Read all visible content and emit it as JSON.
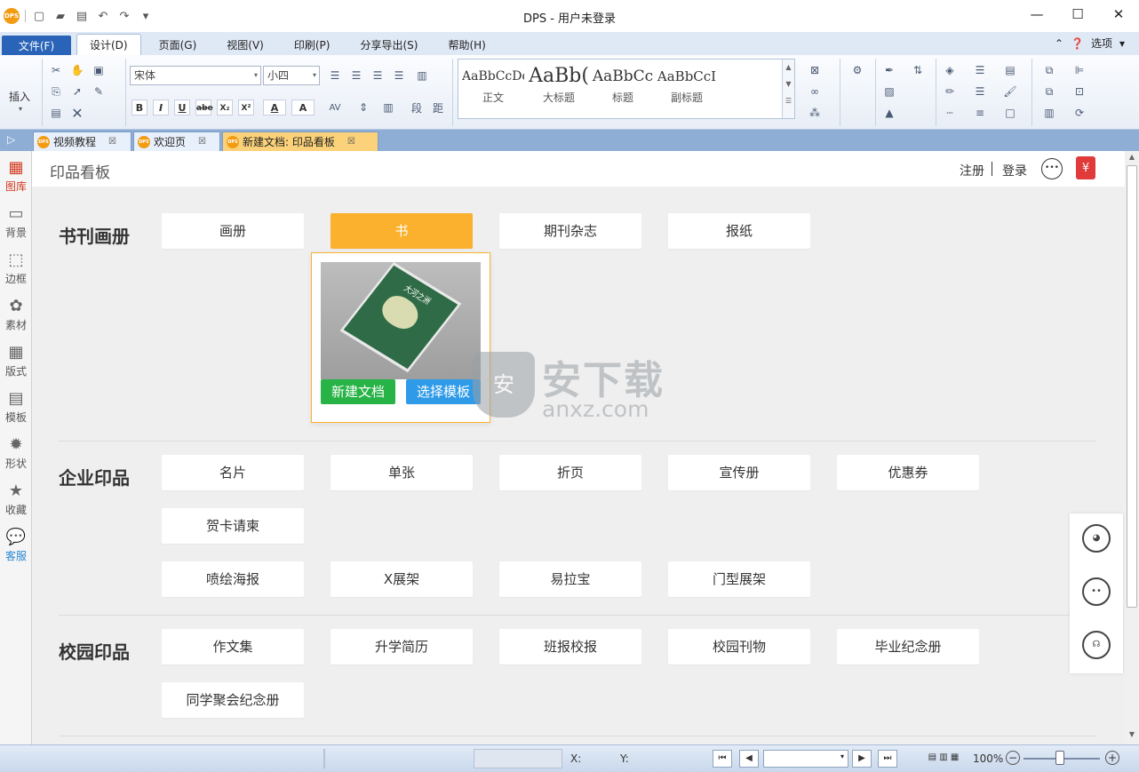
{
  "window": {
    "title": "DPS - 用户未登录"
  },
  "quick_access": {
    "logo": "DPS",
    "icons": [
      "new-doc-icon",
      "open-folder-icon",
      "save-icon",
      "undo-icon",
      "redo-icon",
      "dropdown-icon"
    ]
  },
  "menu": {
    "file": "文件(F)",
    "tabs": [
      "设计(D)",
      "页面(G)",
      "视图(V)",
      "印刷(P)",
      "分享导出(S)",
      "帮助(H)"
    ],
    "options": "选项"
  },
  "ribbon": {
    "insert_label": "插入",
    "font_name": "宋体",
    "font_size": "小四",
    "format_buttons": [
      "B",
      "I",
      "U",
      "abe",
      "X₂",
      "X²",
      "A",
      "A"
    ],
    "styles": [
      {
        "sample": "AaBbCcDd",
        "name": "正文"
      },
      {
        "sample": "AaBb(",
        "name": "大标题"
      },
      {
        "sample": "AaBbCc",
        "name": "标题"
      },
      {
        "sample": "AaBbCcI",
        "name": "副标题"
      }
    ]
  },
  "doc_tabs": [
    {
      "label": "视频教程",
      "icon": "DPS"
    },
    {
      "label": "欢迎页",
      "icon": "DPS"
    },
    {
      "label": "新建文档: 印品看板",
      "icon": "DPS"
    }
  ],
  "leftbar": [
    "图库",
    "背景",
    "边框",
    "素材",
    "版式",
    "模板",
    "形状",
    "收藏",
    "客服"
  ],
  "content": {
    "title": "印品看板",
    "register": "注册",
    "login": "登录",
    "gift_icon": "¥",
    "sections": [
      {
        "title": "书刊画册",
        "items": [
          "画册",
          "书",
          "期刊杂志",
          "报纸"
        ]
      },
      {
        "title": "企业印品",
        "items": [
          "名片",
          "单张",
          "折页",
          "宣传册",
          "优惠券",
          "贺卡请柬",
          "喷绘海报",
          "X展架",
          "易拉宝",
          "门型展架"
        ]
      },
      {
        "title": "校园印品",
        "items": [
          "作文集",
          "升学简历",
          "班报校报",
          "校园刊物",
          "毕业纪念册",
          "同学聚会纪念册"
        ]
      }
    ],
    "popup": {
      "book_title": "大河之洲",
      "new_doc": "新建文档",
      "choose_template": "选择模板"
    },
    "watermark": {
      "cn": "安下载",
      "en": "anxz.com",
      "shield": "安"
    }
  },
  "statusbar": {
    "x_label": "X:",
    "y_label": "Y:",
    "zoom": "100%"
  }
}
